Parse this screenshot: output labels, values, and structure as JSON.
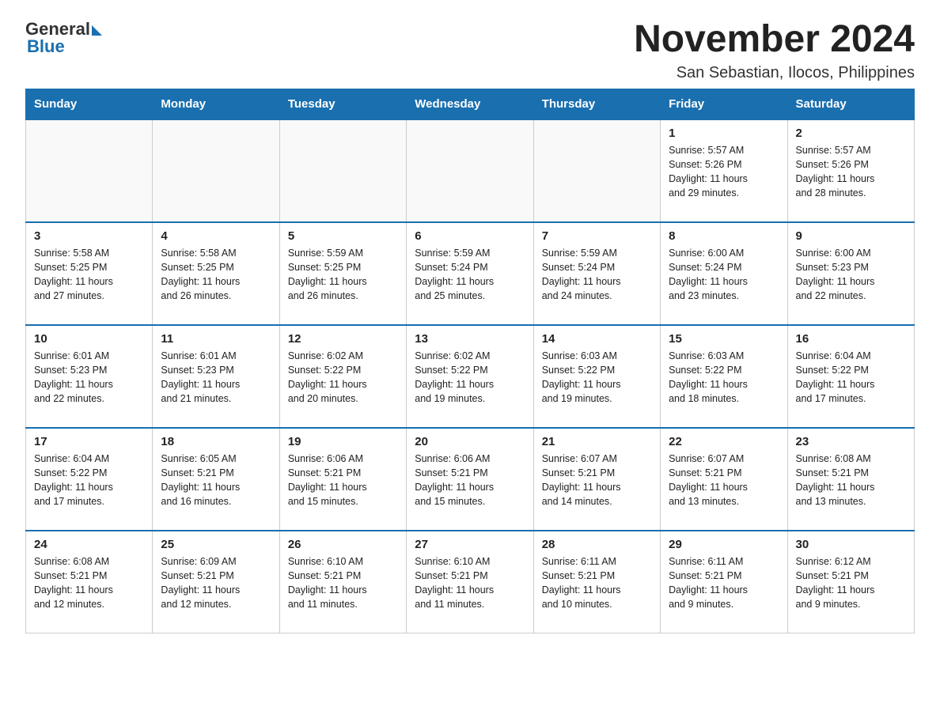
{
  "header": {
    "logo_general": "General",
    "logo_blue": "Blue",
    "title": "November 2024",
    "subtitle": "San Sebastian, Ilocos, Philippines"
  },
  "weekdays": [
    "Sunday",
    "Monday",
    "Tuesday",
    "Wednesday",
    "Thursday",
    "Friday",
    "Saturday"
  ],
  "weeks": [
    [
      {
        "day": "",
        "info": ""
      },
      {
        "day": "",
        "info": ""
      },
      {
        "day": "",
        "info": ""
      },
      {
        "day": "",
        "info": ""
      },
      {
        "day": "",
        "info": ""
      },
      {
        "day": "1",
        "info": "Sunrise: 5:57 AM\nSunset: 5:26 PM\nDaylight: 11 hours\nand 29 minutes."
      },
      {
        "day": "2",
        "info": "Sunrise: 5:57 AM\nSunset: 5:26 PM\nDaylight: 11 hours\nand 28 minutes."
      }
    ],
    [
      {
        "day": "3",
        "info": "Sunrise: 5:58 AM\nSunset: 5:25 PM\nDaylight: 11 hours\nand 27 minutes."
      },
      {
        "day": "4",
        "info": "Sunrise: 5:58 AM\nSunset: 5:25 PM\nDaylight: 11 hours\nand 26 minutes."
      },
      {
        "day": "5",
        "info": "Sunrise: 5:59 AM\nSunset: 5:25 PM\nDaylight: 11 hours\nand 26 minutes."
      },
      {
        "day": "6",
        "info": "Sunrise: 5:59 AM\nSunset: 5:24 PM\nDaylight: 11 hours\nand 25 minutes."
      },
      {
        "day": "7",
        "info": "Sunrise: 5:59 AM\nSunset: 5:24 PM\nDaylight: 11 hours\nand 24 minutes."
      },
      {
        "day": "8",
        "info": "Sunrise: 6:00 AM\nSunset: 5:24 PM\nDaylight: 11 hours\nand 23 minutes."
      },
      {
        "day": "9",
        "info": "Sunrise: 6:00 AM\nSunset: 5:23 PM\nDaylight: 11 hours\nand 22 minutes."
      }
    ],
    [
      {
        "day": "10",
        "info": "Sunrise: 6:01 AM\nSunset: 5:23 PM\nDaylight: 11 hours\nand 22 minutes."
      },
      {
        "day": "11",
        "info": "Sunrise: 6:01 AM\nSunset: 5:23 PM\nDaylight: 11 hours\nand 21 minutes."
      },
      {
        "day": "12",
        "info": "Sunrise: 6:02 AM\nSunset: 5:22 PM\nDaylight: 11 hours\nand 20 minutes."
      },
      {
        "day": "13",
        "info": "Sunrise: 6:02 AM\nSunset: 5:22 PM\nDaylight: 11 hours\nand 19 minutes."
      },
      {
        "day": "14",
        "info": "Sunrise: 6:03 AM\nSunset: 5:22 PM\nDaylight: 11 hours\nand 19 minutes."
      },
      {
        "day": "15",
        "info": "Sunrise: 6:03 AM\nSunset: 5:22 PM\nDaylight: 11 hours\nand 18 minutes."
      },
      {
        "day": "16",
        "info": "Sunrise: 6:04 AM\nSunset: 5:22 PM\nDaylight: 11 hours\nand 17 minutes."
      }
    ],
    [
      {
        "day": "17",
        "info": "Sunrise: 6:04 AM\nSunset: 5:22 PM\nDaylight: 11 hours\nand 17 minutes."
      },
      {
        "day": "18",
        "info": "Sunrise: 6:05 AM\nSunset: 5:21 PM\nDaylight: 11 hours\nand 16 minutes."
      },
      {
        "day": "19",
        "info": "Sunrise: 6:06 AM\nSunset: 5:21 PM\nDaylight: 11 hours\nand 15 minutes."
      },
      {
        "day": "20",
        "info": "Sunrise: 6:06 AM\nSunset: 5:21 PM\nDaylight: 11 hours\nand 15 minutes."
      },
      {
        "day": "21",
        "info": "Sunrise: 6:07 AM\nSunset: 5:21 PM\nDaylight: 11 hours\nand 14 minutes."
      },
      {
        "day": "22",
        "info": "Sunrise: 6:07 AM\nSunset: 5:21 PM\nDaylight: 11 hours\nand 13 minutes."
      },
      {
        "day": "23",
        "info": "Sunrise: 6:08 AM\nSunset: 5:21 PM\nDaylight: 11 hours\nand 13 minutes."
      }
    ],
    [
      {
        "day": "24",
        "info": "Sunrise: 6:08 AM\nSunset: 5:21 PM\nDaylight: 11 hours\nand 12 minutes."
      },
      {
        "day": "25",
        "info": "Sunrise: 6:09 AM\nSunset: 5:21 PM\nDaylight: 11 hours\nand 12 minutes."
      },
      {
        "day": "26",
        "info": "Sunrise: 6:10 AM\nSunset: 5:21 PM\nDaylight: 11 hours\nand 11 minutes."
      },
      {
        "day": "27",
        "info": "Sunrise: 6:10 AM\nSunset: 5:21 PM\nDaylight: 11 hours\nand 11 minutes."
      },
      {
        "day": "28",
        "info": "Sunrise: 6:11 AM\nSunset: 5:21 PM\nDaylight: 11 hours\nand 10 minutes."
      },
      {
        "day": "29",
        "info": "Sunrise: 6:11 AM\nSunset: 5:21 PM\nDaylight: 11 hours\nand 9 minutes."
      },
      {
        "day": "30",
        "info": "Sunrise: 6:12 AM\nSunset: 5:21 PM\nDaylight: 11 hours\nand 9 minutes."
      }
    ]
  ]
}
